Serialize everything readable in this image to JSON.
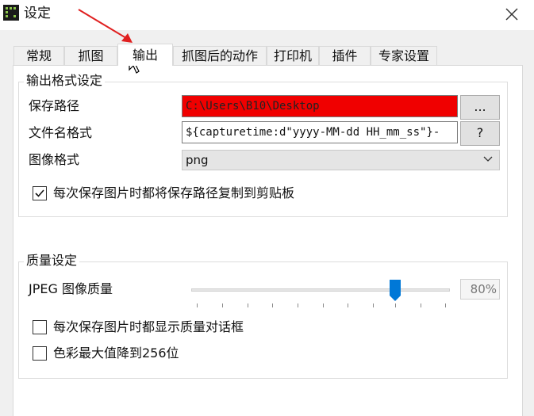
{
  "window": {
    "title": "设定"
  },
  "tabs": [
    {
      "label": "常规"
    },
    {
      "label": "抓图"
    },
    {
      "label": "输出",
      "active": true
    },
    {
      "label": "抓图后的动作"
    },
    {
      "label": "打印机"
    },
    {
      "label": "插件"
    },
    {
      "label": "专家设置"
    }
  ],
  "output_group": {
    "title": "输出格式设定",
    "save_path_label": "保存路径",
    "save_path_value": "C:\\Users\\B10\\Desktop",
    "browse_label": "...",
    "filename_label": "文件名格式",
    "filename_value": "${capturetime:d\"yyyy-MM-dd HH_mm_ss\"}-",
    "help_label": "?",
    "image_format_label": "图像格式",
    "image_format_value": "png",
    "copy_path_checkbox_label": "每次保存图片时都将保存路径复制到剪贴板",
    "copy_path_checked": true
  },
  "quality_group": {
    "title": "质量设定",
    "jpeg_label": "JPEG 图像质量",
    "jpeg_quality": 80,
    "jpeg_quality_text": "80%",
    "show_dialog_label": "每次保存图片时都显示质量对话框",
    "show_dialog_checked": false,
    "reduce_colors_label": "色彩最大值降到256位",
    "reduce_colors_checked": false
  },
  "colors": {
    "path_highlight": "#f00000",
    "accent": "#0078d7",
    "annotation_arrow": "#e02020"
  }
}
